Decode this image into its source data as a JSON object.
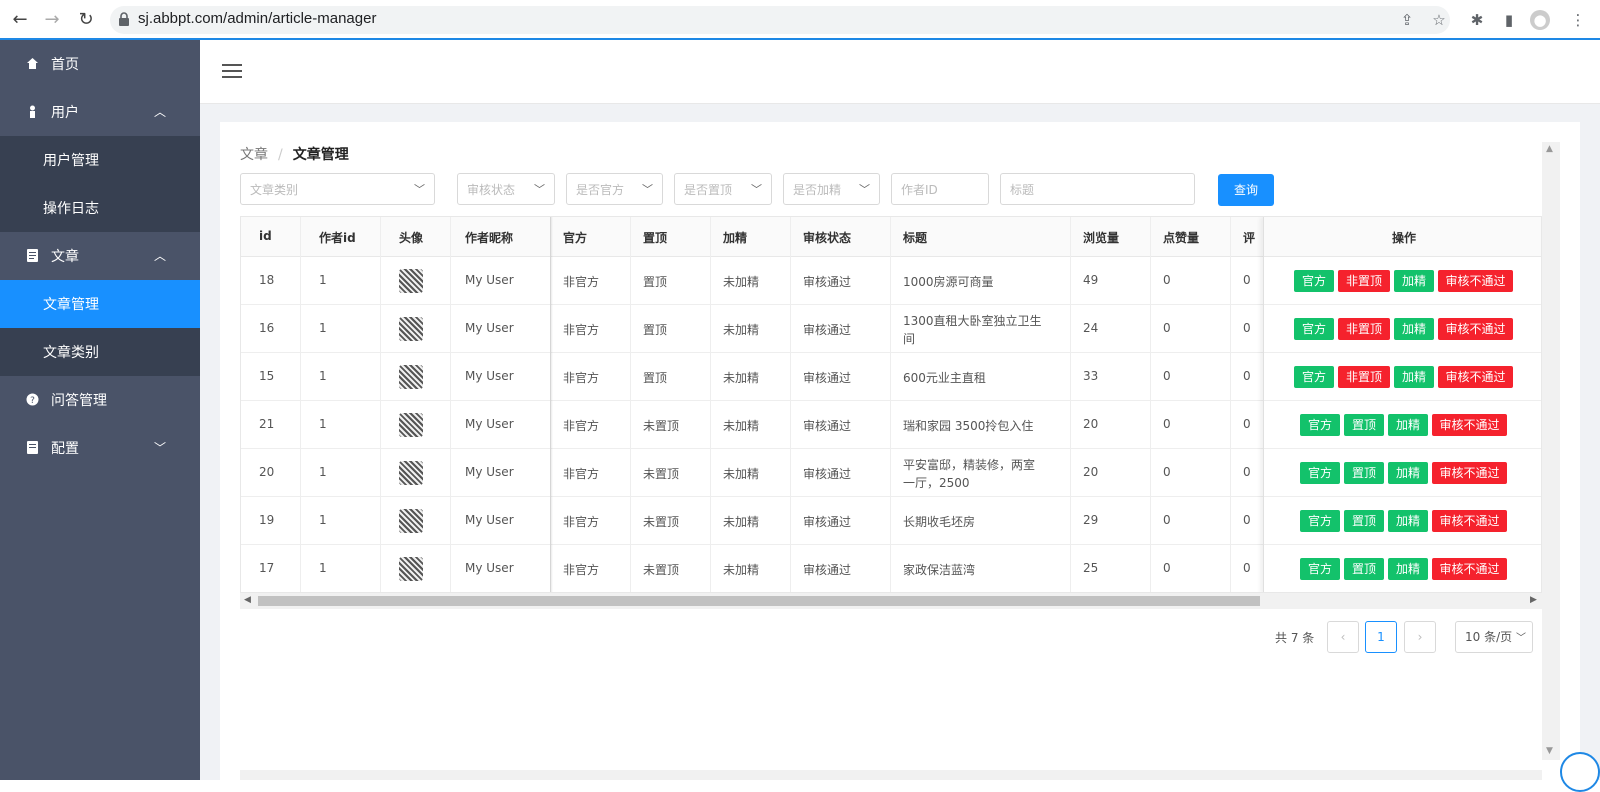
{
  "browser": {
    "url": "sj.abbpt.com/admin/article-manager"
  },
  "sidebar": {
    "items": [
      {
        "label": "首页"
      },
      {
        "label": "用户"
      },
      {
        "label": "用户管理"
      },
      {
        "label": "操作日志"
      },
      {
        "label": "文章"
      },
      {
        "label": "文章管理"
      },
      {
        "label": "文章类别"
      },
      {
        "label": "问答管理"
      },
      {
        "label": "配置"
      }
    ]
  },
  "breadcrumb": {
    "parent": "文章",
    "sep": "/",
    "current": "文章管理"
  },
  "filters": {
    "category": "文章类别",
    "review": "审核状态",
    "official": "是否官方",
    "top": "是否置顶",
    "featured": "是否加精",
    "author_id": "作者ID",
    "title": "标题",
    "query": "查询"
  },
  "table": {
    "headers": [
      "id",
      "作者id",
      "头像",
      "作者昵称",
      "官方",
      "置顶",
      "加精",
      "审核状态",
      "标题",
      "浏览量",
      "点赞量",
      "评",
      "操作"
    ],
    "rows": [
      {
        "id": "18",
        "author": "1",
        "nick": "My User",
        "official": "非官方",
        "top": "置顶",
        "feat": "未加精",
        "review": "审核通过",
        "title": "1000房源可商量",
        "views": "49",
        "likes": "0",
        "comments": "0",
        "a1": "官方",
        "a2": "非置顶",
        "a3": "加精",
        "a4": "审核不通过"
      },
      {
        "id": "16",
        "author": "1",
        "nick": "My User",
        "official": "非官方",
        "top": "置顶",
        "feat": "未加精",
        "review": "审核通过",
        "title": "1300直租大卧室独立卫生",
        "title2": "间",
        "views": "24",
        "likes": "0",
        "comments": "0",
        "a1": "官方",
        "a2": "非置顶",
        "a3": "加精",
        "a4": "审核不通过"
      },
      {
        "id": "15",
        "author": "1",
        "nick": "My User",
        "official": "非官方",
        "top": "置顶",
        "feat": "未加精",
        "review": "审核通过",
        "title": "600元业主直租",
        "views": "33",
        "likes": "0",
        "comments": "0",
        "a1": "官方",
        "a2": "非置顶",
        "a3": "加精",
        "a4": "审核不通过"
      },
      {
        "id": "21",
        "author": "1",
        "nick": "My User",
        "official": "非官方",
        "top": "未置顶",
        "feat": "未加精",
        "review": "审核通过",
        "title": "瑞和家园 3500拎包入住",
        "views": "20",
        "likes": "0",
        "comments": "0",
        "a1": "官方",
        "a2": "置顶",
        "a3": "加精",
        "a4": "审核不通过"
      },
      {
        "id": "20",
        "author": "1",
        "nick": "My User",
        "official": "非官方",
        "top": "未置顶",
        "feat": "未加精",
        "review": "审核通过",
        "title": "平安富邸，精装修，两室",
        "title2": "一厅，2500",
        "views": "20",
        "likes": "0",
        "comments": "0",
        "a1": "官方",
        "a2": "置顶",
        "a3": "加精",
        "a4": "审核不通过"
      },
      {
        "id": "19",
        "author": "1",
        "nick": "My User",
        "official": "非官方",
        "top": "未置顶",
        "feat": "未加精",
        "review": "审核通过",
        "title": "长期收毛坯房",
        "views": "29",
        "likes": "0",
        "comments": "0",
        "a1": "官方",
        "a2": "置顶",
        "a3": "加精",
        "a4": "审核不通过"
      },
      {
        "id": "17",
        "author": "1",
        "nick": "My User",
        "official": "非官方",
        "top": "未置顶",
        "feat": "未加精",
        "review": "审核通过",
        "title": "家政保洁蓝湾",
        "views": "25",
        "likes": "0",
        "comments": "0",
        "a1": "官方",
        "a2": "置顶",
        "a3": "加精",
        "a4": "审核不通过"
      }
    ]
  },
  "pagination": {
    "total": "共 7 条",
    "prev": "‹",
    "page": "1",
    "next": "›",
    "size": "10 条/页"
  },
  "colors": {
    "primary": "#1890ff",
    "success": "#13c26b",
    "danger": "#f5222d",
    "sidebar": "#4a5368"
  }
}
